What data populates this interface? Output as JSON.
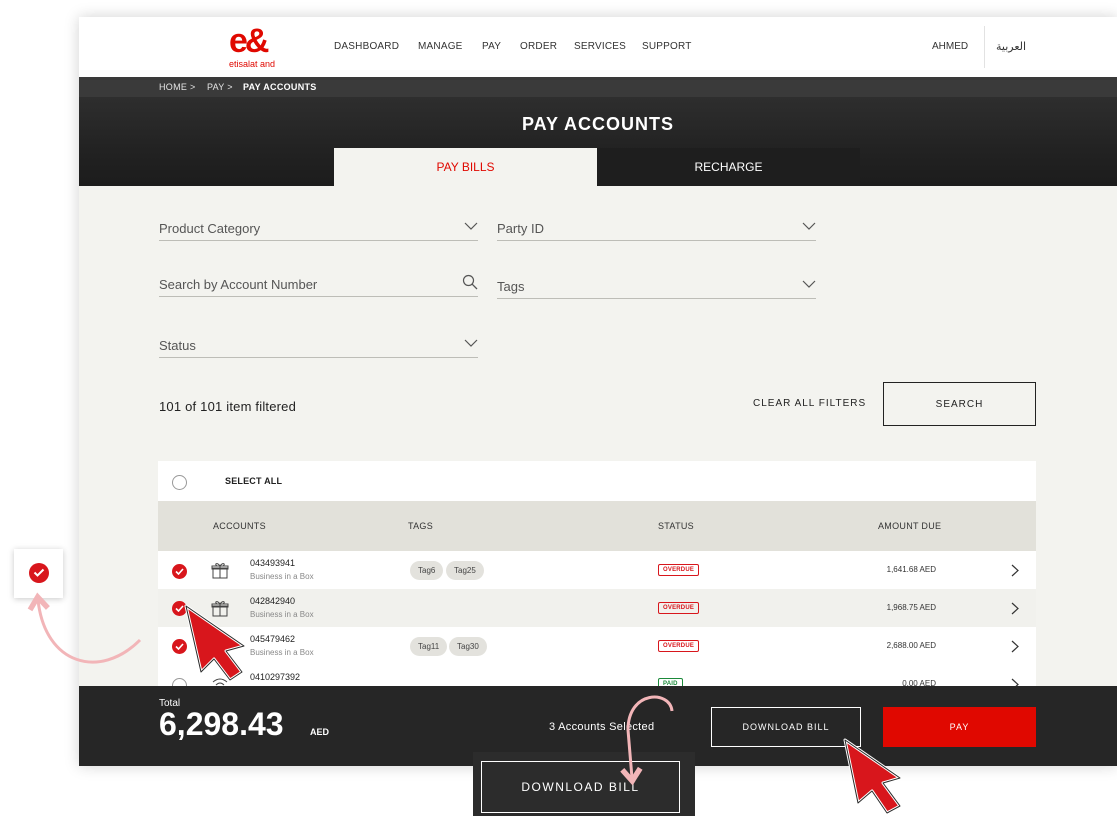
{
  "header": {
    "logo_mark": "e&",
    "logo_text": "etisalat and",
    "nav": [
      "DASHBOARD",
      "MANAGE",
      "PAY",
      "ORDER",
      "SERVICES",
      "SUPPORT"
    ],
    "user": "AHMED",
    "language": "العربية"
  },
  "breadcrumb": [
    "HOME >",
    "PAY >",
    "PAY ACCOUNTS"
  ],
  "page_title": "PAY ACCOUNTS",
  "tabs": [
    {
      "label": "PAY BILLS",
      "active": true
    },
    {
      "label": "RECHARGE",
      "active": false
    }
  ],
  "filters": {
    "product_category": "Product Category",
    "party_id": "Party ID",
    "search_account": "Search by Account Number",
    "tags": "Tags",
    "status": "Status"
  },
  "results": {
    "count_text": "101 of 101 item filtered",
    "clear_all": "CLEAR ALL FILTERS",
    "search": "SEARCH"
  },
  "table": {
    "select_all": "SELECT ALL",
    "headers": [
      "ACCOUNTS",
      "TAGS",
      "STATUS",
      "AMOUNT DUE"
    ],
    "rows": [
      {
        "number": "043493941",
        "type": "Business in a Box",
        "tags": [
          "Tag6",
          "Tag25"
        ],
        "status": "OVERDUE",
        "amount": "1,641.68 AED",
        "selected": true,
        "icon": "gift-icon"
      },
      {
        "number": "042842940",
        "type": "Business in a Box",
        "tags": [],
        "status": "OVERDUE",
        "amount": "1,968.75 AED",
        "selected": true,
        "icon": "gift-icon"
      },
      {
        "number": "045479462",
        "type": "Business in a Box",
        "tags": [
          "Tag11",
          "Tag30"
        ],
        "status": "OVERDUE",
        "amount": "2,688.00 AED",
        "selected": true,
        "icon": "gift-icon"
      },
      {
        "number": "0410297392",
        "type": "",
        "tags": [],
        "status": "PAID",
        "amount": "0.00 AED",
        "selected": false,
        "icon": "wifi-icon"
      }
    ]
  },
  "footer": {
    "total_label": "Total",
    "total_value": "6,298.43",
    "currency": "AED",
    "selected_text": "3 Accounts Selected",
    "download_bill": "DOWNLOAD BILL",
    "pay": "PAY"
  },
  "colors": {
    "brand_red": "#e00800",
    "check_red": "#d8161c",
    "dark": "#262626",
    "page_bg": "#f3f3ef"
  }
}
